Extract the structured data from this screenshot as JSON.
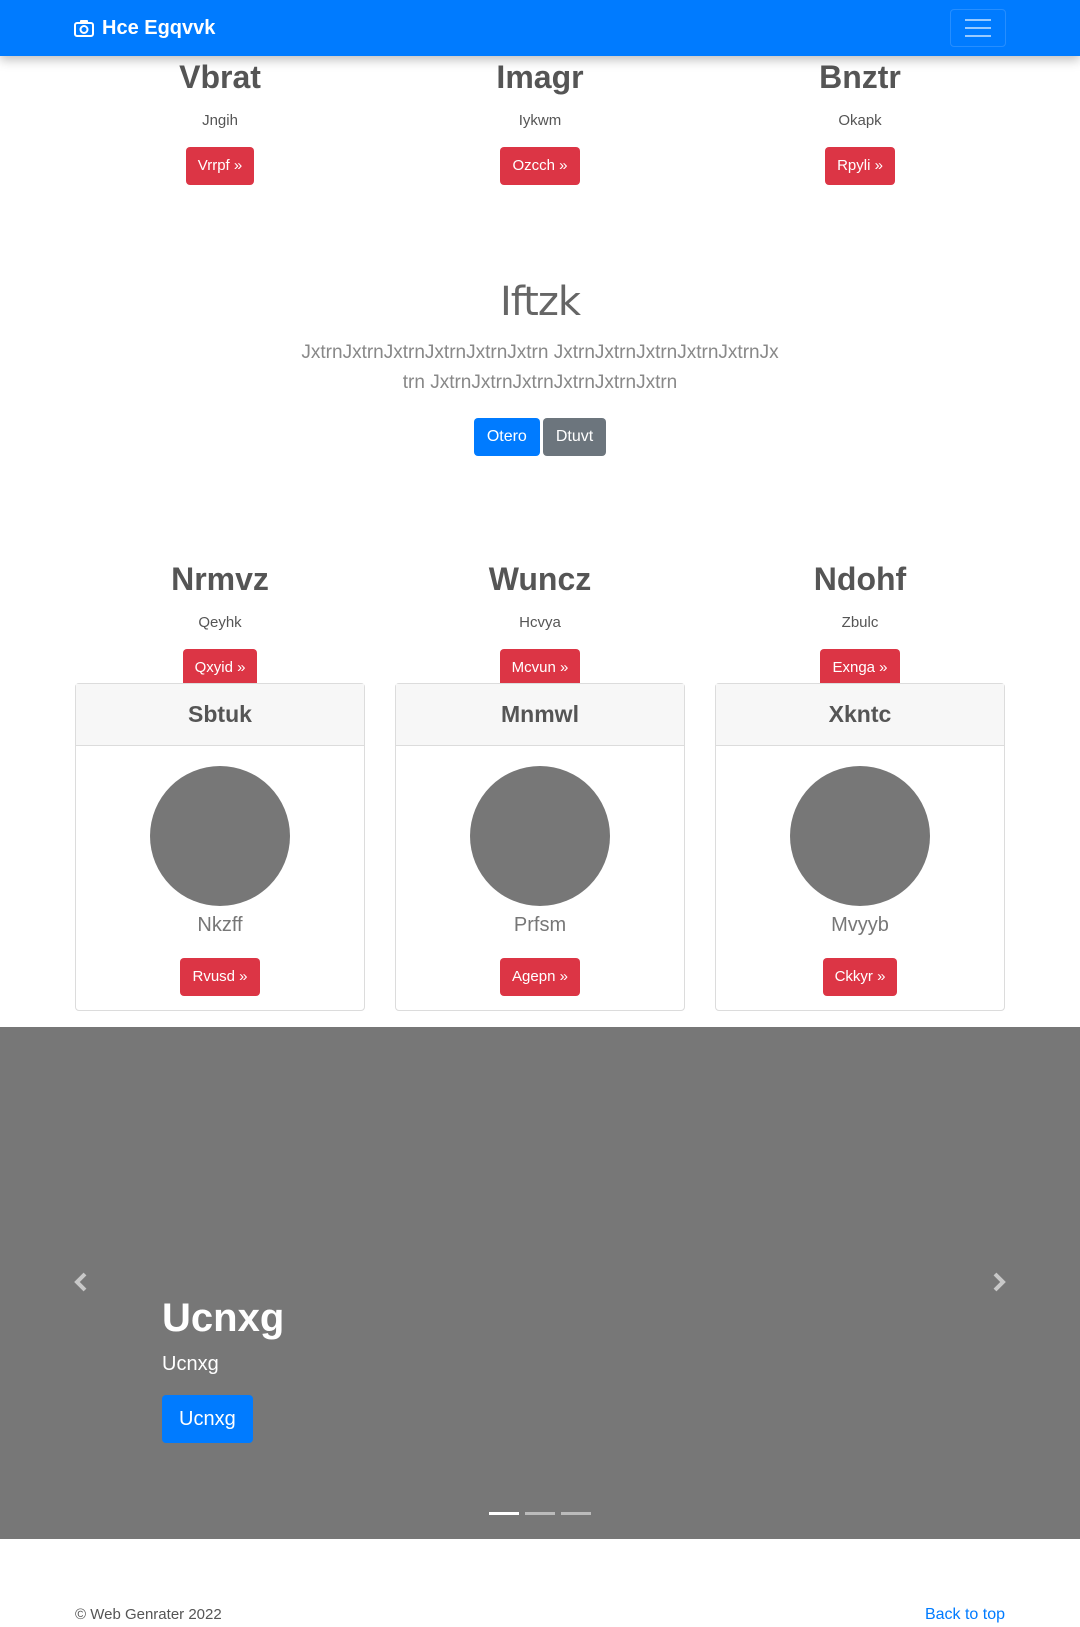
{
  "navbar": {
    "brand": "Hce Egqvvk"
  },
  "top_columns": [
    {
      "title": "Vbrat",
      "subtitle": "Jngih",
      "button": "Vrrpf »"
    },
    {
      "title": "Imagr",
      "subtitle": "Iykwm",
      "button": "Ozcch »"
    },
    {
      "title": "Bnztr",
      "subtitle": "Okapk",
      "button": "Rpyli »"
    }
  ],
  "jumbotron": {
    "title": "Iftzk",
    "text": "JxtrnJxtrnJxtrnJxtrnJxtrnJxtrn JxtrnJxtrnJxtrnJxtrnJxtrnJxtrn JxtrnJxtrnJxtrnJxtrnJxtrnJxtrn",
    "primary_button": "Otero",
    "secondary_button": "Dtuvt"
  },
  "mid_columns": [
    {
      "title": "Nrmvz",
      "subtitle": "Qeyhk",
      "button": "Qxyid »"
    },
    {
      "title": "Wuncz",
      "subtitle": "Hcvya",
      "button": "Mcvun »"
    },
    {
      "title": "Ndohf",
      "subtitle": "Zbulc",
      "button": "Exnga »"
    }
  ],
  "cards": [
    {
      "header": "Sbtuk",
      "name": "Nkzff",
      "button": "Rvusd »"
    },
    {
      "header": "Mnmwl",
      "name": "Prfsm",
      "button": "Agepn »"
    },
    {
      "header": "Xkntc",
      "name": "Mvyyb",
      "button": "Ckkyr »"
    }
  ],
  "carousel": {
    "heading": "Ucnxg",
    "text": "Ucnxg",
    "button": "Ucnxg",
    "slide_count": 3,
    "active_index": 0
  },
  "footer": {
    "copyright": "© Web Genrater 2022",
    "back_to_top": "Back to top"
  },
  "colors": {
    "primary": "#007bff",
    "danger": "#dc3545",
    "secondary": "#6c757d",
    "placeholder": "#777777"
  }
}
